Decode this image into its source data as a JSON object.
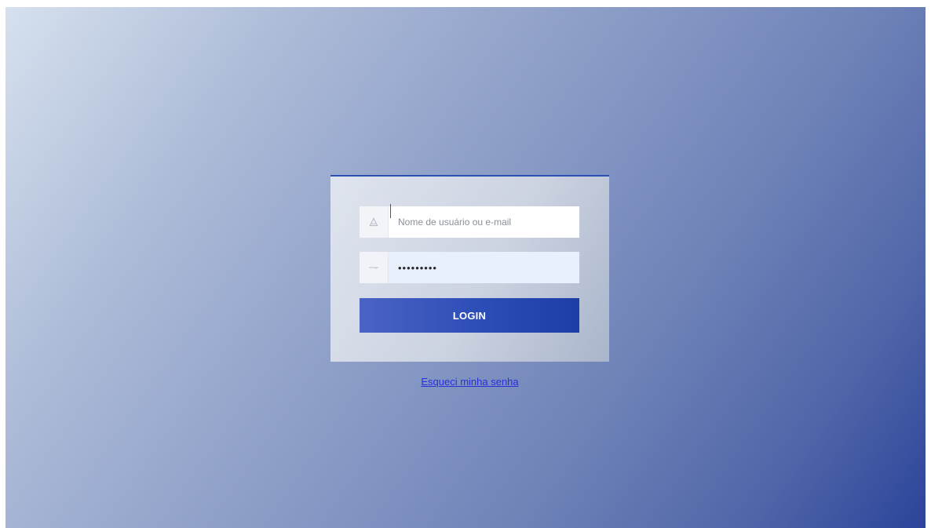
{
  "colors": {
    "accent": "#2d4fb3",
    "button": "#2f4fb8",
    "link": "#2a2fd8"
  },
  "login": {
    "username_placeholder": "Nome de usuário ou e-mail",
    "username_value": "",
    "username_icon": "user-icon",
    "password_value": "•••••••••",
    "password_icon": "key-icon",
    "button_label": "LOGIN",
    "forgot_label": "Esqueci minha senha"
  }
}
